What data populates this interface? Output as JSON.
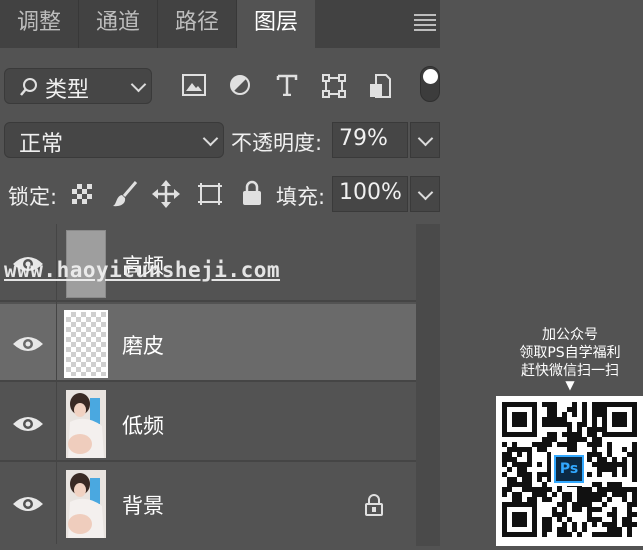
{
  "tabs": [
    {
      "label": "调整",
      "active": false
    },
    {
      "label": "通道",
      "active": false
    },
    {
      "label": "路径",
      "active": false
    },
    {
      "label": "图层",
      "active": true
    }
  ],
  "filter": {
    "label": "类型",
    "icons": [
      "image-filter-icon",
      "adjustment-filter-icon",
      "type-filter-icon",
      "shape-filter-icon",
      "smart-object-filter-icon",
      "filter-toggle-icon"
    ]
  },
  "blend": {
    "mode": "正常",
    "opacity_label": "不透明度:",
    "opacity_value": "79%"
  },
  "lock": {
    "label": "锁定:",
    "fill_label": "填充:",
    "fill_value": "100%",
    "icons": [
      "lock-transparent-icon",
      "lock-image-icon",
      "lock-position-icon",
      "lock-artboard-icon",
      "lock-all-icon"
    ]
  },
  "layers": [
    {
      "name": "高频",
      "selected": false,
      "thumb": "gray",
      "locked": false
    },
    {
      "name": "磨皮",
      "selected": true,
      "thumb": "transparent",
      "locked": false
    },
    {
      "name": "低频",
      "selected": false,
      "thumb": "photo",
      "locked": false
    },
    {
      "name": "背景",
      "selected": false,
      "thumb": "photo",
      "locked": true
    }
  ],
  "watermark": "www.haoyicunsheji.com",
  "promo": {
    "line1": "加公众号",
    "line2": "领取PS自学福利",
    "line3": "赶快微信扫一扫",
    "arrow": "▼",
    "qr_center": "Ps"
  },
  "colors": {
    "panel": "#535353",
    "tabbar": "#424242",
    "selected_row": "#6a6a6a",
    "ps_blue": "#31a8ff"
  }
}
